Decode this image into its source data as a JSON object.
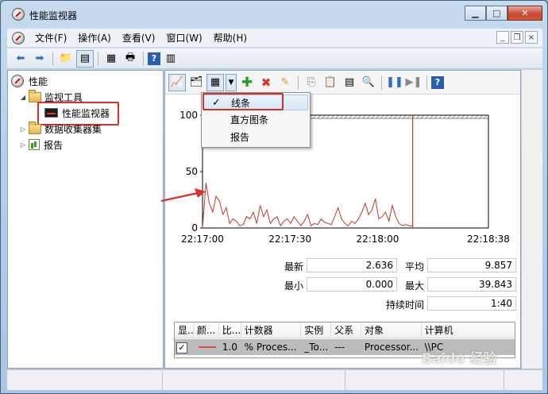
{
  "window": {
    "title": "性能监视器",
    "controls": {
      "minimize": "▁",
      "maximize": "□",
      "close": "✕"
    }
  },
  "menubar": {
    "items": [
      "文件(F)",
      "操作(A)",
      "查看(V)",
      "窗口(W)",
      "帮助(H)"
    ]
  },
  "nav_tree": {
    "root": "性能",
    "monitor_tools": "监视工具",
    "perf_monitor": "性能监视器",
    "data_collector_sets": "数据收集器集",
    "reports": "报告"
  },
  "graph_menu": {
    "items": [
      "线条",
      "直方图条",
      "报告"
    ],
    "checked_index": 0,
    "check_mark": "✓"
  },
  "chart_data": {
    "type": "line",
    "x_ticks": [
      "22:17:00",
      "22:17:30",
      "22:18:00",
      "22:18:38"
    ],
    "y_ticks": [
      "100",
      "50",
      "0"
    ],
    "ylim": [
      0,
      100
    ],
    "series": [
      {
        "color": "#c0392b",
        "values": [
          0,
          40,
          22,
          14,
          28,
          24,
          12,
          18,
          4,
          8,
          6,
          2,
          3,
          10,
          8,
          14,
          4,
          20,
          10,
          16,
          4,
          8,
          10,
          2,
          6,
          8,
          4,
          10,
          6,
          2,
          6,
          12,
          2,
          4,
          3,
          8,
          5,
          4,
          3,
          10,
          18,
          8,
          4,
          2,
          6,
          4,
          8,
          14,
          22,
          12,
          16,
          26,
          8,
          10,
          14,
          6,
          20,
          10,
          4,
          2,
          3,
          2,
          2
        ]
      }
    ],
    "cursor_line_at": 0.735
  },
  "stats": {
    "latest_label": "最新",
    "latest_value": "2.636",
    "average_label": "平均",
    "average_value": "9.857",
    "min_label": "最小",
    "min_value": "0.000",
    "max_label": "最大",
    "max_value": "39.843",
    "duration_label": "持续时间",
    "duration_value": "1:40"
  },
  "counter_table": {
    "headers": [
      "显...",
      "颜...",
      "比...",
      "计数器",
      "实例",
      "父系",
      "对象",
      "计算机"
    ],
    "row": {
      "show": "✓",
      "scale": "1.0",
      "counter": "% Proces...",
      "instance": "_To...",
      "parent": "---",
      "object": "Processor...",
      "computer": "\\\\PC"
    },
    "color": "#d9302b"
  },
  "watermark": "Baidu 经验"
}
